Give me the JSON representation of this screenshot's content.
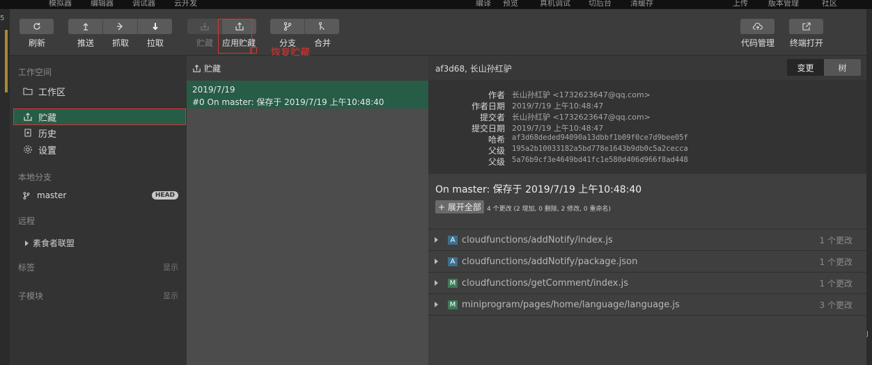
{
  "top_menu": [
    "模拟器",
    "编辑器",
    "调试器",
    "云开发",
    "编译",
    "预览",
    "真机调试",
    "切后台",
    "清缓存",
    "上传",
    "版本管理",
    "社区"
  ],
  "left_edge_char": "5",
  "right_edge_char": "J",
  "toolbar": {
    "refresh": "刷新",
    "push": "推送",
    "fetch": "抓取",
    "pull": "拉取",
    "stash": "贮藏",
    "apply_stash": "应用贮藏",
    "branch": "分支",
    "merge": "合并",
    "code_management": "代码管理",
    "open_terminal": "终端打开",
    "annotation": "恢复贮藏"
  },
  "sidebar": {
    "workspace_title": "工作空间",
    "items": [
      "工作区",
      "贮藏",
      "历史",
      "设置"
    ],
    "local_branches_title": "本地分支",
    "branch_name": "master",
    "branch_badge": "HEAD",
    "remote_title": "远程",
    "remote_name": "素食者联盟",
    "tags_title": "标签",
    "tags_hint": "显示",
    "submodules_title": "子模块",
    "submodules_hint": "显示"
  },
  "stash_panel": {
    "header": "贮藏",
    "entry_date": "2019/7/19",
    "entry_message": "#0  On master: 保存于 2019/7/19 上午10:48:40"
  },
  "detail": {
    "header": "af3d68, 长山孙红驴",
    "view_changes": "变更",
    "view_tree": "树",
    "meta": [
      {
        "k": "作者",
        "v": "长山孙红驴 <1732623647@qq.com>",
        "mono": false
      },
      {
        "k": "作者日期",
        "v": "2019/7/19 上午10:48:47",
        "mono": false
      },
      {
        "k": "提交者",
        "v": "长山孙红驴 <1732623647@qq.com>",
        "mono": false
      },
      {
        "k": "提交日期",
        "v": "2019/7/19 上午10:48:47",
        "mono": false
      },
      {
        "k": "哈希",
        "v": "af3d68deded94090a13dbbf1b09f0ce7d9bee05f",
        "mono": true
      },
      {
        "k": "父级",
        "v": "195a2b10033182a5bd778e1643b9db0c5a2cecca",
        "mono": true
      },
      {
        "k": "父级",
        "v": "5a76b9cf3e4649bd41fc1e580d406d966f8ad448",
        "mono": true
      }
    ],
    "message_title": "On master: 保存于 2019/7/19 上午10:48:40",
    "expand_all": "+ 展开全部",
    "change_summary": "4 个更改 (2 增加, 0 删除, 2 修改, 0 重命名)",
    "files": [
      {
        "type": "A",
        "path": "cloudfunctions/addNotify/index.js",
        "count": "1 个更改"
      },
      {
        "type": "A",
        "path": "cloudfunctions/addNotify/package.json",
        "count": "1 个更改"
      },
      {
        "type": "M",
        "path": "cloudfunctions/getComment/index.js",
        "count": "1 个更改"
      },
      {
        "type": "M",
        "path": "miniprogram/pages/home/language/language.js",
        "count": "3 个更改"
      }
    ]
  },
  "colors": {
    "selection_green": "#275c47",
    "highlight_red": "#dd3333",
    "added_badge": "#3d6f8e",
    "modified_badge": "#3c7a57"
  }
}
